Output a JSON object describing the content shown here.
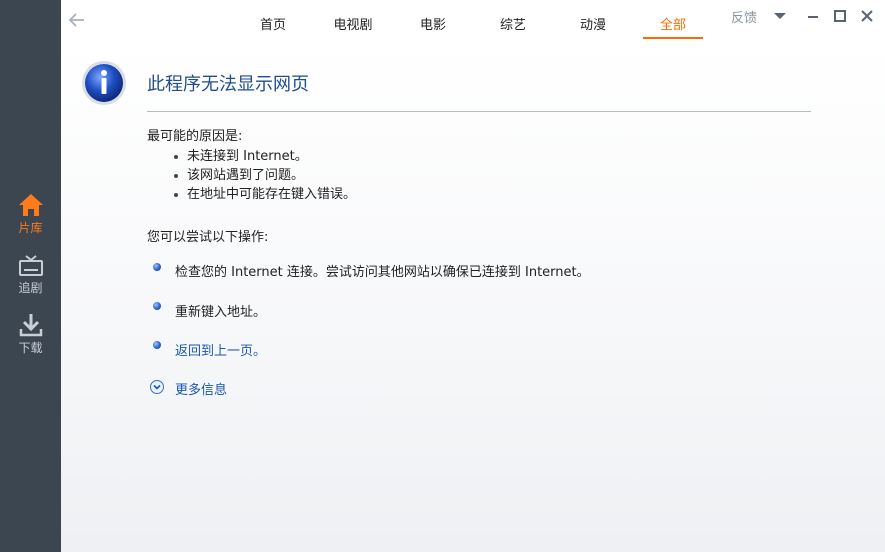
{
  "sidebar": {
    "items": [
      {
        "label": "片库",
        "icon": "home-icon",
        "active": true
      },
      {
        "label": "追剧",
        "icon": "tv-icon",
        "active": false
      },
      {
        "label": "下载",
        "icon": "download-icon",
        "active": false
      }
    ]
  },
  "topbar": {
    "tabs": [
      {
        "label": "首页"
      },
      {
        "label": "电视剧"
      },
      {
        "label": "电影"
      },
      {
        "label": "综艺"
      },
      {
        "label": "动漫"
      },
      {
        "label": "全部",
        "active": true
      }
    ],
    "feedback": "反馈"
  },
  "error_page": {
    "title": "此程序无法显示网页",
    "causes_heading": "最可能的原因是:",
    "causes": [
      "未连接到 Internet。",
      "该网站遇到了问题。",
      "在地址中可能存在键入错误。"
    ],
    "actions_heading": "您可以尝试以下操作:",
    "actions": [
      "检查您的 Internet 连接。尝试访问其他网站以确保已连接到 Internet。",
      "重新键入地址。",
      "返回到上一页。"
    ],
    "more_info": "更多信息"
  },
  "colors": {
    "sidebar_bg": "#3c4651",
    "accent": "#ff6a00",
    "title_blue": "#1f4e8c"
  }
}
